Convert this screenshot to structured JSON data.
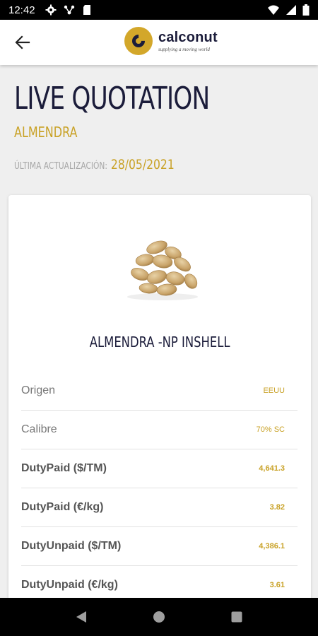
{
  "status_bar": {
    "time": "12:42",
    "icons_left": [
      "gear-icon",
      "network-icon",
      "sd-card-icon"
    ],
    "icons_right": [
      "wifi-icon",
      "signal-icon",
      "battery-icon"
    ]
  },
  "app_bar": {
    "logo_name": "calconut",
    "logo_tagline": "supplying a moving world",
    "back_icon": "arrow-left-icon"
  },
  "header": {
    "title": "LIVE QUOTATION",
    "subtitle": "ALMENDRA",
    "updated_label": "ÚLTIMA ACTUALIZACIÓN:",
    "updated_date": "28/05/2021"
  },
  "colors": {
    "navy": "#1b1c3a",
    "gold": "#c9a227",
    "logo_gold": "#d3a72a"
  },
  "product": {
    "name": "ALMENDRA -NP INSHELL",
    "rows": [
      {
        "label": "Origen",
        "value": "EEUU"
      },
      {
        "label": "Calibre",
        "value": "70% SC"
      },
      {
        "label": "DutyPaid ($/TM)",
        "value": "4,641.3"
      },
      {
        "label": "DutyPaid (€/kg)",
        "value": "3.82"
      },
      {
        "label": "DutyUnpaid ($/TM)",
        "value": "4,386.1"
      },
      {
        "label": "DutyUnpaid (€/kg)",
        "value": "3.61"
      }
    ]
  },
  "nav_bar": {
    "buttons": [
      "back-triangle-icon",
      "home-circle-icon",
      "recents-square-icon"
    ]
  }
}
